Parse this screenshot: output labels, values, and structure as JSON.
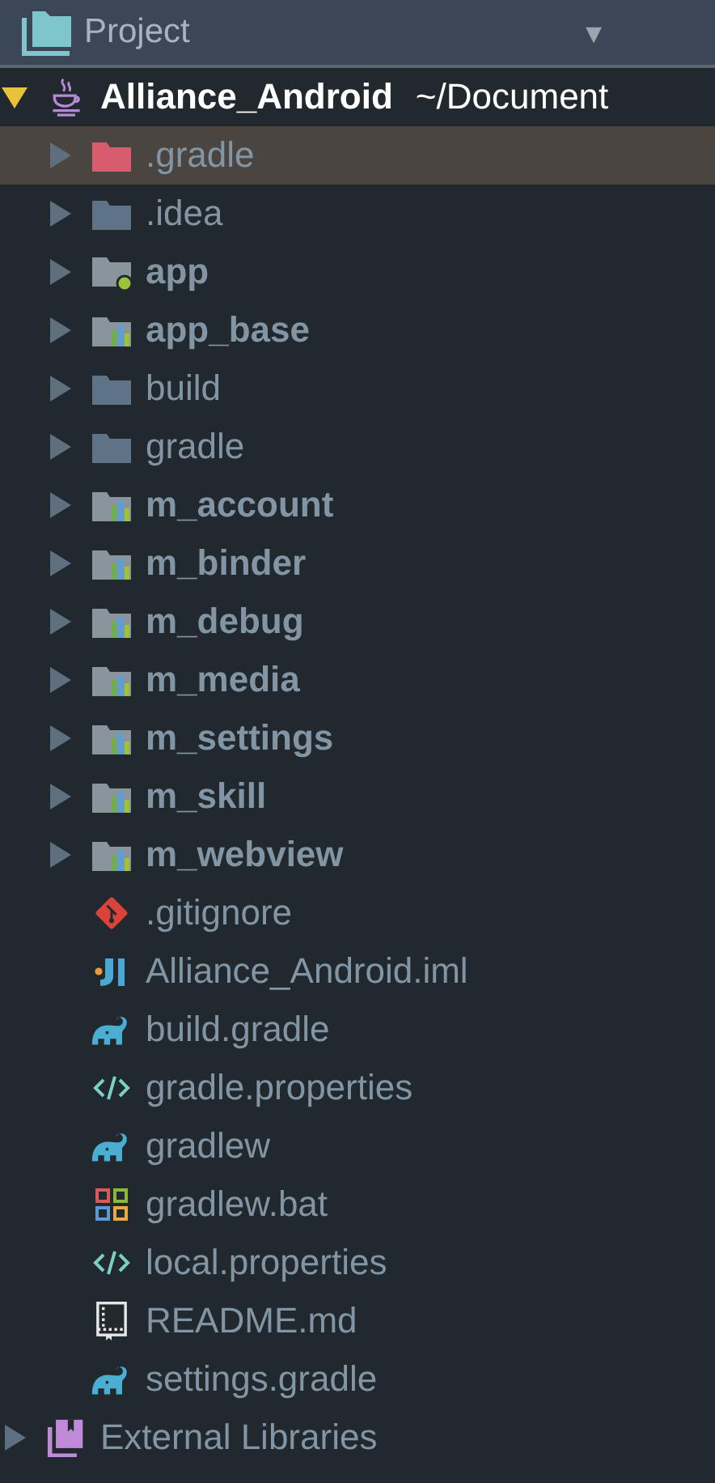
{
  "header": {
    "title": "Project",
    "menu": "▾"
  },
  "tree": [
    {
      "kind": "project",
      "name": "Alliance_Android",
      "path": "~/Document",
      "expanded": true,
      "selected": false,
      "children": [
        {
          "kind": "excluded",
          "name": ".gradle",
          "expanded": false,
          "selected": true
        },
        {
          "kind": "folder",
          "name": ".idea",
          "expanded": false,
          "selected": false
        },
        {
          "kind": "app_module",
          "name": "app",
          "expanded": false,
          "selected": false
        },
        {
          "kind": "module",
          "name": "app_base",
          "expanded": false,
          "selected": false
        },
        {
          "kind": "folder",
          "name": "build",
          "expanded": false,
          "selected": false
        },
        {
          "kind": "folder",
          "name": "gradle",
          "expanded": false,
          "selected": false
        },
        {
          "kind": "module",
          "name": "m_account",
          "expanded": false,
          "selected": false
        },
        {
          "kind": "module",
          "name": "m_binder",
          "expanded": false,
          "selected": false
        },
        {
          "kind": "module",
          "name": "m_debug",
          "expanded": false,
          "selected": false
        },
        {
          "kind": "module",
          "name": "m_media",
          "expanded": false,
          "selected": false
        },
        {
          "kind": "module",
          "name": "m_settings",
          "expanded": false,
          "selected": false
        },
        {
          "kind": "module",
          "name": "m_skill",
          "expanded": false,
          "selected": false
        },
        {
          "kind": "module",
          "name": "m_webview",
          "expanded": false,
          "selected": false
        },
        {
          "kind": "git",
          "name": ".gitignore",
          "selected": false
        },
        {
          "kind": "iml",
          "name": "Alliance_Android.iml",
          "selected": false
        },
        {
          "kind": "gradle",
          "name": "build.gradle",
          "selected": false
        },
        {
          "kind": "properties",
          "name": "gradle.properties",
          "selected": false
        },
        {
          "kind": "gradle",
          "name": "gradlew",
          "selected": false
        },
        {
          "kind": "bat",
          "name": "gradlew.bat",
          "selected": false
        },
        {
          "kind": "properties",
          "name": "local.properties",
          "selected": false
        },
        {
          "kind": "readme",
          "name": "README.md",
          "selected": false
        },
        {
          "kind": "gradle",
          "name": "settings.gradle",
          "selected": false
        }
      ]
    },
    {
      "kind": "libraries",
      "name": "External Libraries",
      "expanded": false,
      "selected": false
    }
  ]
}
